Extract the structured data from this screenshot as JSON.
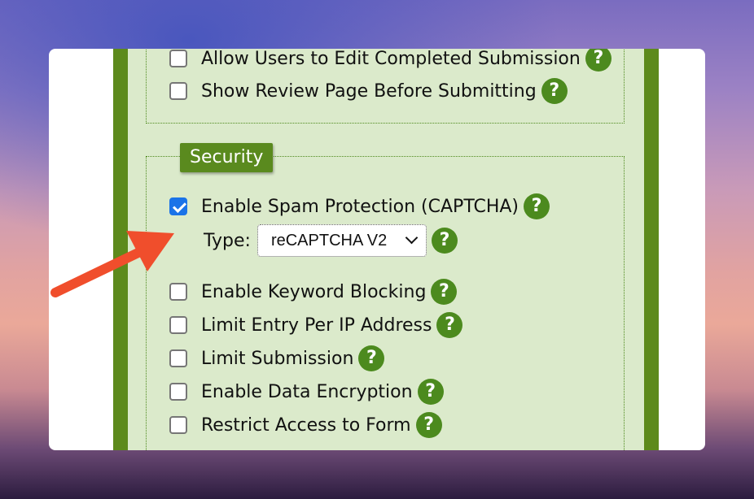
{
  "top_options": [
    {
      "label": "Allow Users to Edit Completed Submission",
      "checked": false
    },
    {
      "label": "Show Review Page Before Submitting",
      "checked": false
    }
  ],
  "security": {
    "legend": "Security",
    "spam": {
      "label": "Enable Spam Protection (CAPTCHA)",
      "checked": true
    },
    "type_label": "Type:",
    "type_value": "reCAPTCHA V2",
    "options": [
      {
        "label": "Enable Keyword Blocking",
        "checked": false
      },
      {
        "label": "Limit Entry Per IP Address",
        "checked": false
      },
      {
        "label": "Limit Submission",
        "checked": false
      },
      {
        "label": "Enable Data Encryption",
        "checked": false
      },
      {
        "label": "Restrict Access to Form",
        "checked": false
      }
    ]
  },
  "help_glyph": "?",
  "colors": {
    "accent_green": "#5d8a1c",
    "checkbox_blue": "#1a73e8",
    "arrow_red": "#f04e2c",
    "panel_bg": "#dbeacb"
  },
  "icons": {
    "help": "question-circle-icon",
    "annotation": "red-arrow-icon",
    "dropdown": "chevron-down-icon"
  }
}
